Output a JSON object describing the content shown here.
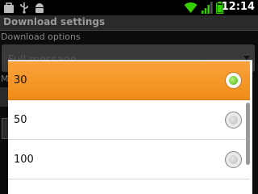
{
  "status_bar": {
    "time": "12:14",
    "icons": [
      "bag-icon",
      "usb-icon",
      "android-icon",
      "wifi-icon",
      "signal-icon",
      "battery-icon"
    ]
  },
  "title_bar": {
    "title": "Download settings"
  },
  "background": {
    "section_label": "Download options",
    "spinner_value": "Full message",
    "partial_label": "M"
  },
  "dialog": {
    "options": [
      {
        "label": "30",
        "selected": true
      },
      {
        "label": "50",
        "selected": false
      },
      {
        "label": "100",
        "selected": false
      }
    ]
  },
  "colors": {
    "accent": "#f39a24",
    "radio_selected": "#47b80f"
  }
}
